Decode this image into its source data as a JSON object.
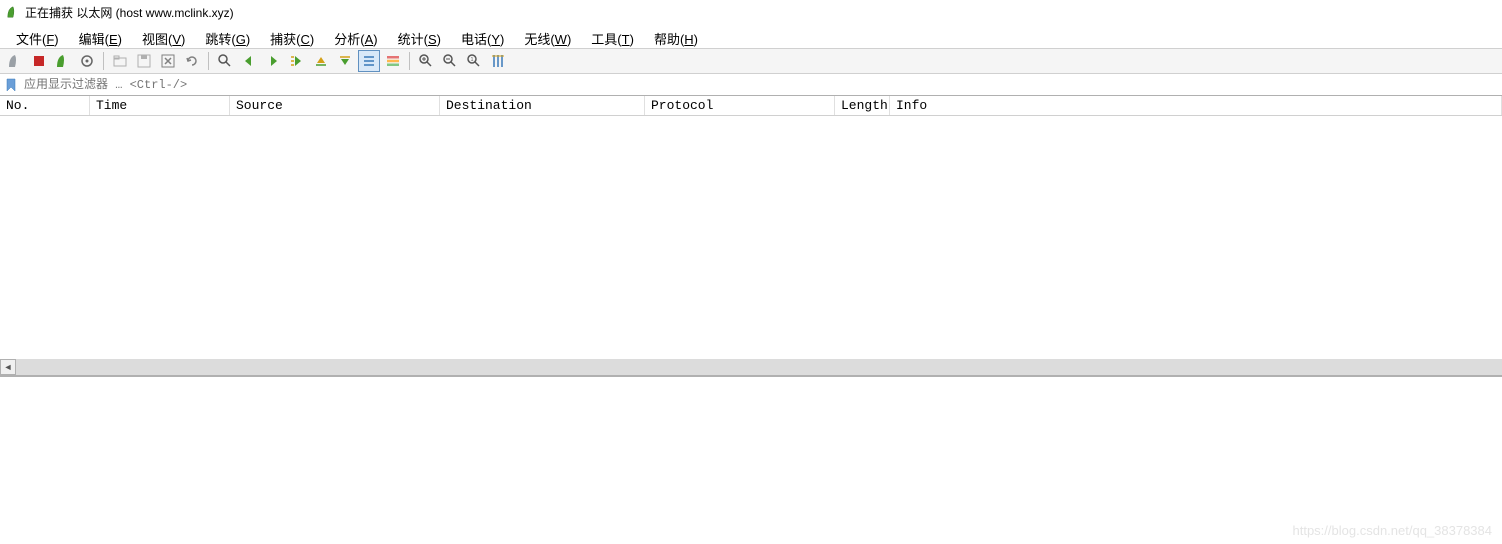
{
  "title": "正在捕获 以太网 (host www.mclink.xyz)",
  "menu": {
    "file": "文件(F)",
    "edit": "编辑(E)",
    "view": "视图(V)",
    "go": "跳转(G)",
    "capture": "捕获(C)",
    "analyze": "分析(A)",
    "statistics": "统计(S)",
    "telephony": "电话(Y)",
    "wireless": "无线(W)",
    "tools": "工具(T)",
    "help": "帮助(H)"
  },
  "toolbar": {
    "start": "start-capture",
    "stop": "stop-capture",
    "restart": "restart-capture",
    "options": "capture-options",
    "open": "open-file",
    "save": "save-file",
    "close": "close-file",
    "reload": "reload-file",
    "find": "find-packet",
    "prev": "go-back",
    "next": "go-forward",
    "jump": "go-to-packet",
    "first": "go-first",
    "last": "go-last",
    "autoscroll": "auto-scroll",
    "colorize": "colorize",
    "zoomin": "zoom-in",
    "zoomout": "zoom-out",
    "zoomreset": "zoom-reset",
    "resize": "resize-columns"
  },
  "filter": {
    "placeholder": "应用显示过滤器 … <Ctrl-/>"
  },
  "columns": {
    "no": "No.",
    "time": "Time",
    "source": "Source",
    "dest": "Destination",
    "protocol": "Protocol",
    "length": "Length",
    "info": "Info"
  },
  "watermark": "https://blog.csdn.net/qq_38378384"
}
